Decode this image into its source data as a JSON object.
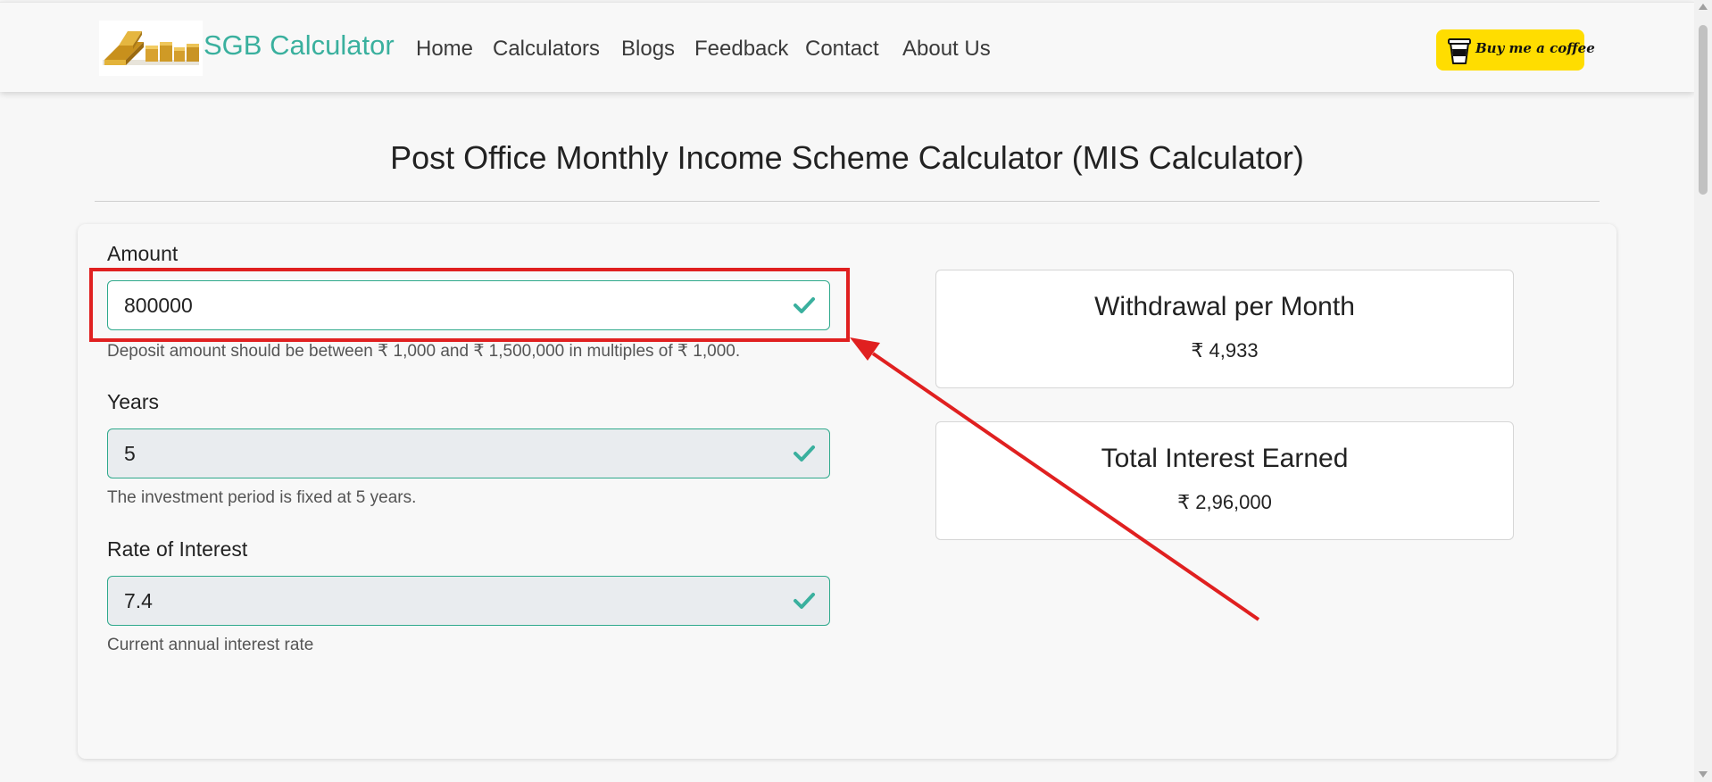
{
  "nav": {
    "brand": "SGB Calculator",
    "links": [
      "Home",
      "Calculators",
      "Blogs",
      "Feedback",
      "Contact",
      "About Us"
    ],
    "coffee_button": "Buy me a coffee"
  },
  "page": {
    "title": "Post Office Monthly Income Scheme Calculator (MIS Calculator)"
  },
  "form": {
    "amount": {
      "label": "Amount",
      "value": "800000",
      "help": "Deposit amount should be between ₹ 1,000 and ₹ 1,500,000 in multiples of ₹ 1,000."
    },
    "years": {
      "label": "Years",
      "value": "5",
      "help": "The investment period is fixed at 5 years."
    },
    "rate": {
      "label": "Rate of Interest",
      "value": "7.4",
      "help": "Current annual interest rate"
    }
  },
  "results": {
    "withdrawal": {
      "title": "Withdrawal per Month",
      "value": "₹ 4,933"
    },
    "interest": {
      "title": "Total Interest Earned",
      "value": "₹ 2,96,000"
    }
  },
  "colors": {
    "brand": "#3ab09e",
    "valid_border": "#2fa98c",
    "check": "#3ab09e",
    "coffee_button": "#ffdd00",
    "annotation": "#e02020"
  },
  "icons": {
    "logo": "gold-bars-logo",
    "coffee": "coffee-cup-icon",
    "valid": "checkmark-icon"
  }
}
